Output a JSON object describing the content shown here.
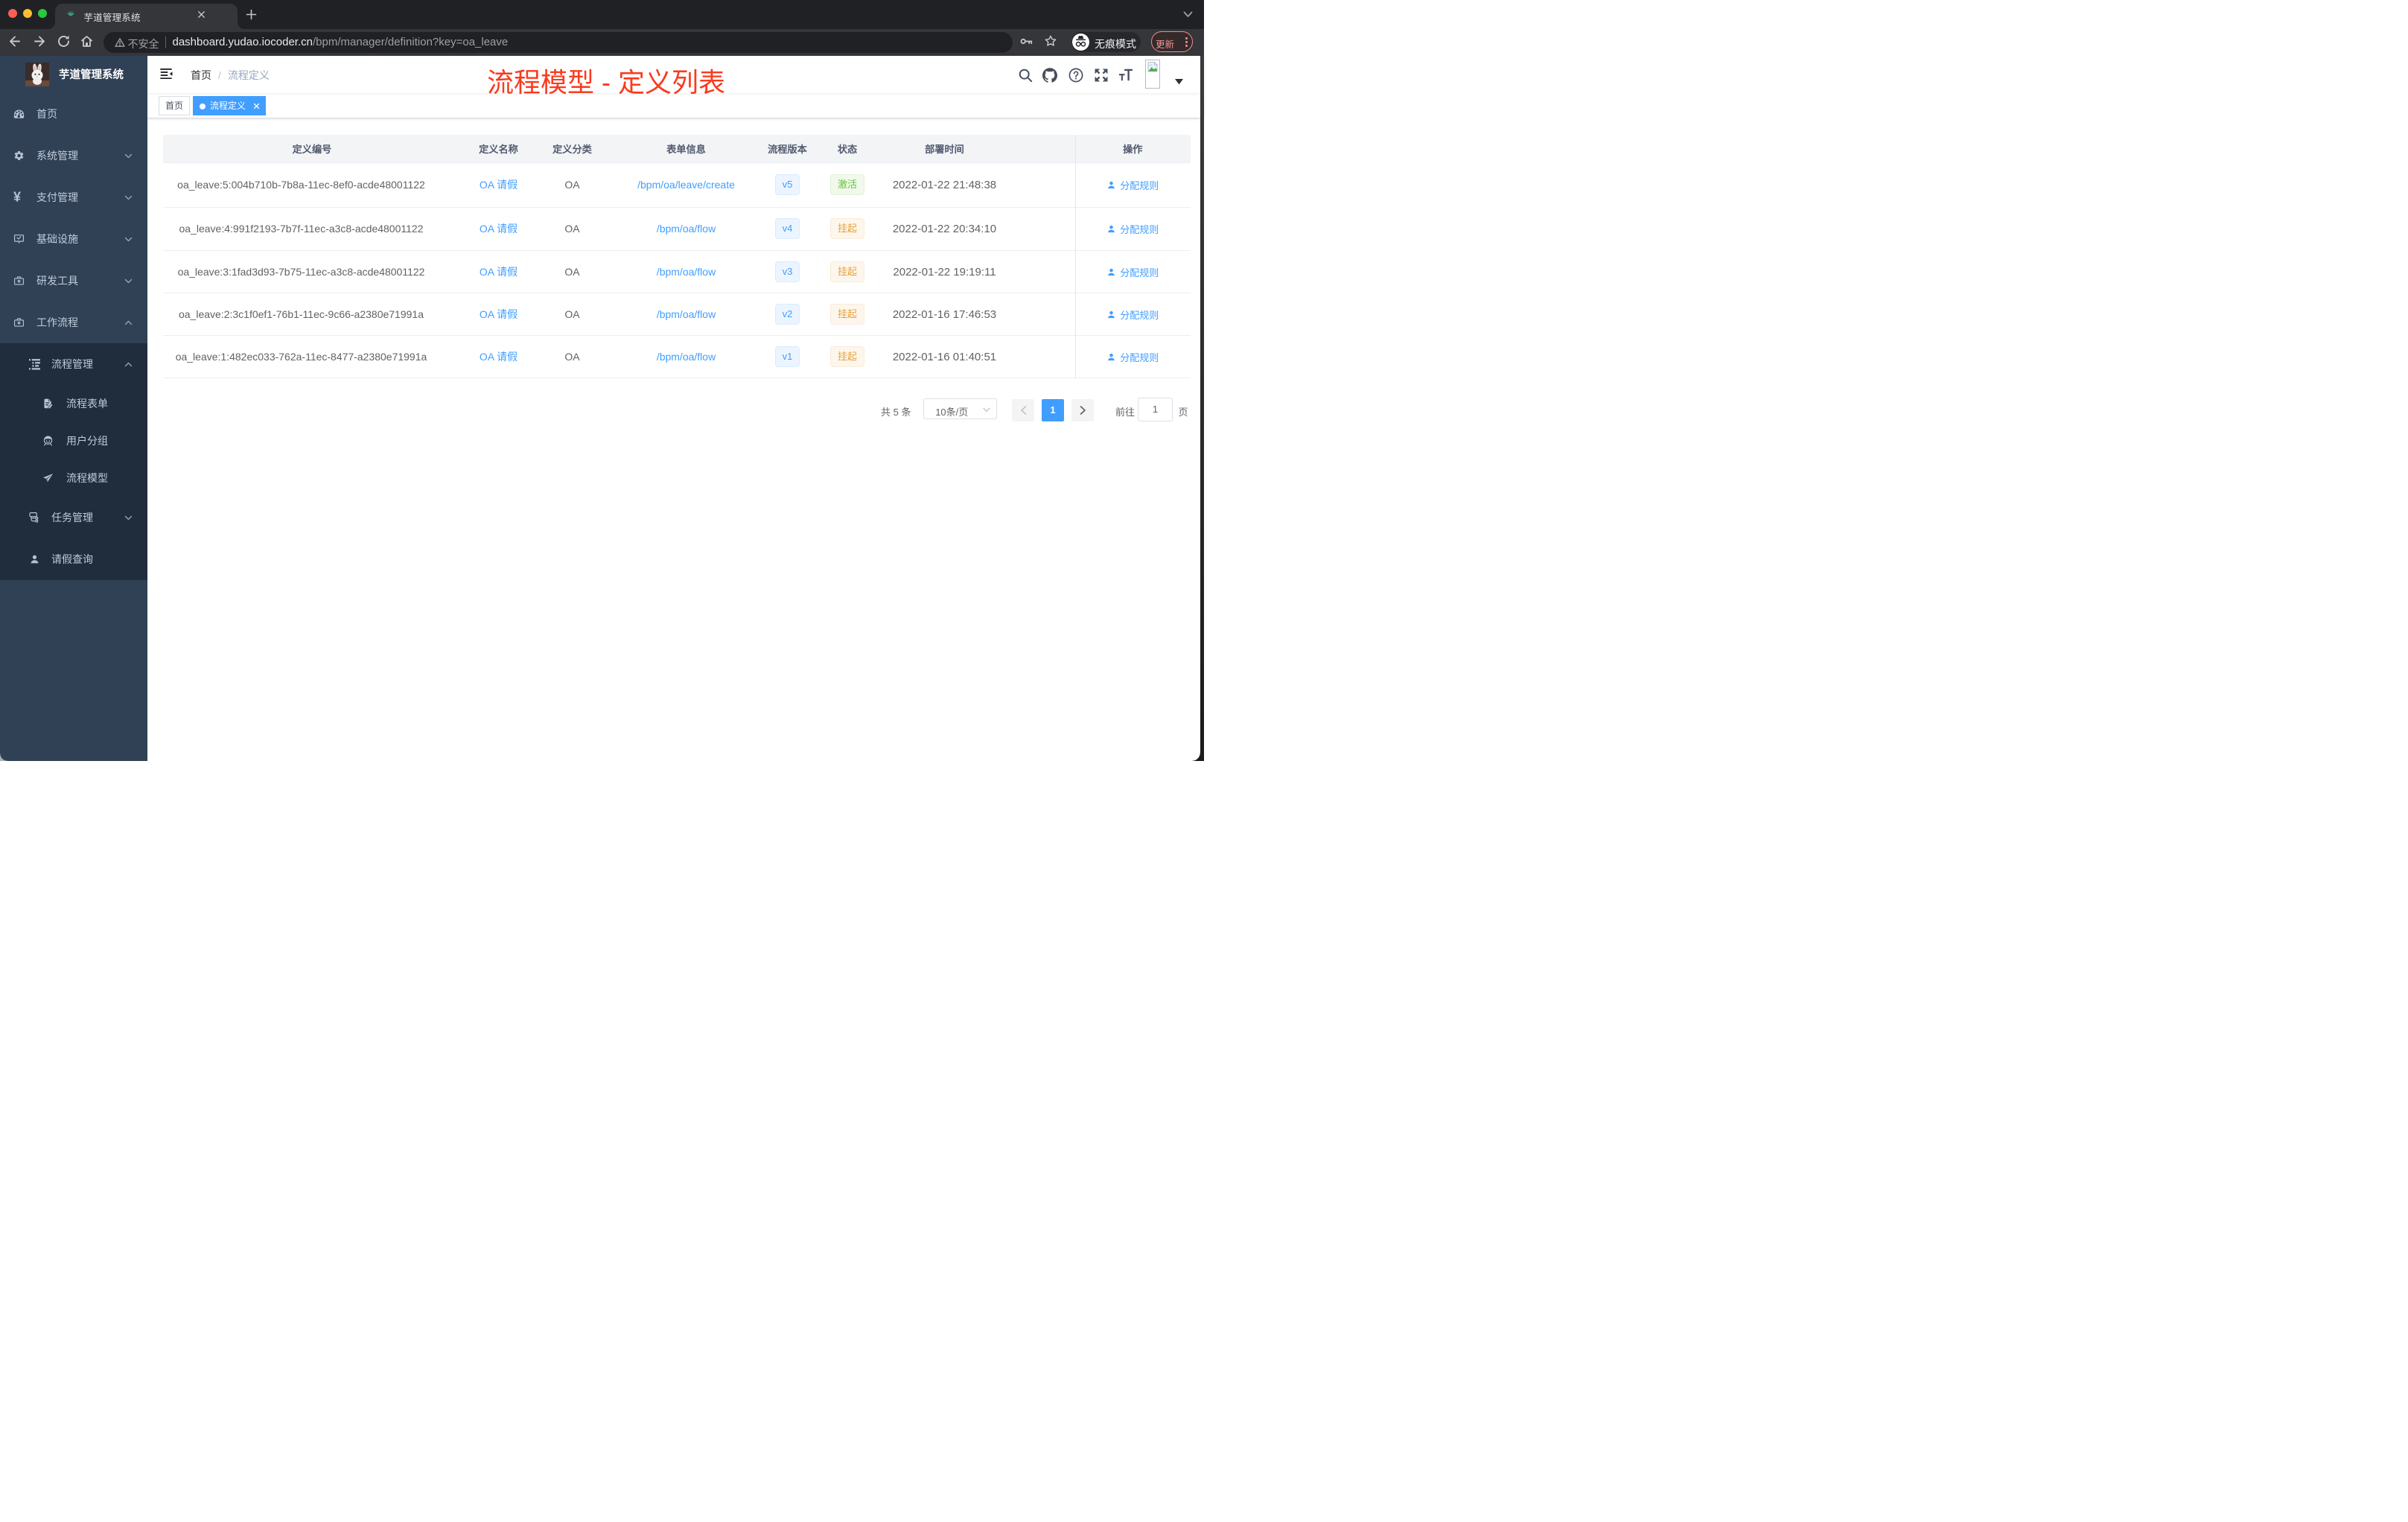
{
  "browser": {
    "tab_title": "芋道管理系统",
    "security_label": "不安全",
    "url_host": "dashboard.yudao.iocoder.cn",
    "url_path": "/bpm/manager/definition?key=oa_leave",
    "incognito_label": "无痕模式",
    "update_label": "更新"
  },
  "sidebar": {
    "logo_title": "芋道管理系统",
    "items": [
      {
        "label": "首页"
      },
      {
        "label": "系统管理"
      },
      {
        "label": "支付管理"
      },
      {
        "label": "基础设施"
      },
      {
        "label": "研发工具"
      },
      {
        "label": "工作流程"
      },
      {
        "label": "流程管理"
      },
      {
        "label": "流程表单"
      },
      {
        "label": "用户分组"
      },
      {
        "label": "流程模型"
      },
      {
        "label": "任务管理"
      },
      {
        "label": "请假查询"
      }
    ]
  },
  "navbar": {
    "breadcrumb_home": "首页",
    "breadcrumb_sep": "/",
    "breadcrumb_current": "流程定义",
    "annotation": "流程模型 - 定义列表"
  },
  "tags": {
    "home": "首页",
    "current": "流程定义"
  },
  "table": {
    "columns": {
      "id": "定义编号",
      "name": "定义名称",
      "category": "定义分类",
      "form": "表单信息",
      "version": "流程版本",
      "status": "状态",
      "time": "部署时间",
      "action": "操作"
    },
    "rows": [
      {
        "id": "oa_leave:5:004b710b-7b8a-11ec-8ef0-acde48001122",
        "name": "OA 请假",
        "category": "OA",
        "form": "/bpm/oa/leave/create",
        "version": "v5",
        "status": "激活",
        "time": "2022-01-22 21:48:38",
        "action": "分配规则"
      },
      {
        "id": "oa_leave:4:991f2193-7b7f-11ec-a3c8-acde48001122",
        "name": "OA 请假",
        "category": "OA",
        "form": "/bpm/oa/flow",
        "version": "v4",
        "status": "挂起",
        "time": "2022-01-22 20:34:10",
        "action": "分配规则"
      },
      {
        "id": "oa_leave:3:1fad3d93-7b75-11ec-a3c8-acde48001122",
        "name": "OA 请假",
        "category": "OA",
        "form": "/bpm/oa/flow",
        "version": "v3",
        "status": "挂起",
        "time": "2022-01-22 19:19:11",
        "action": "分配规则"
      },
      {
        "id": "oa_leave:2:3c1f0ef1-76b1-11ec-9c66-a2380e71991a",
        "name": "OA 请假",
        "category": "OA",
        "form": "/bpm/oa/flow",
        "version": "v2",
        "status": "挂起",
        "time": "2022-01-16 17:46:53",
        "action": "分配规则"
      },
      {
        "id": "oa_leave:1:482ec033-762a-11ec-8477-a2380e71991a",
        "name": "OA 请假",
        "category": "OA",
        "form": "/bpm/oa/flow",
        "version": "v1",
        "status": "挂起",
        "time": "2022-01-16 01:40:51",
        "action": "分配规则"
      }
    ]
  },
  "pagination": {
    "total": "共 5 条",
    "page_size": "10条/页",
    "current_page": "1",
    "goto_label": "前往",
    "goto_value": "1",
    "page_label": "页"
  },
  "colors": {
    "accent": "#409eff",
    "sidebar": "#304156",
    "sidebar_dark": "#1f2d3d",
    "annotation_red": "#fb3a1e",
    "success": "#67c23a",
    "warning": "#e6a23c"
  }
}
